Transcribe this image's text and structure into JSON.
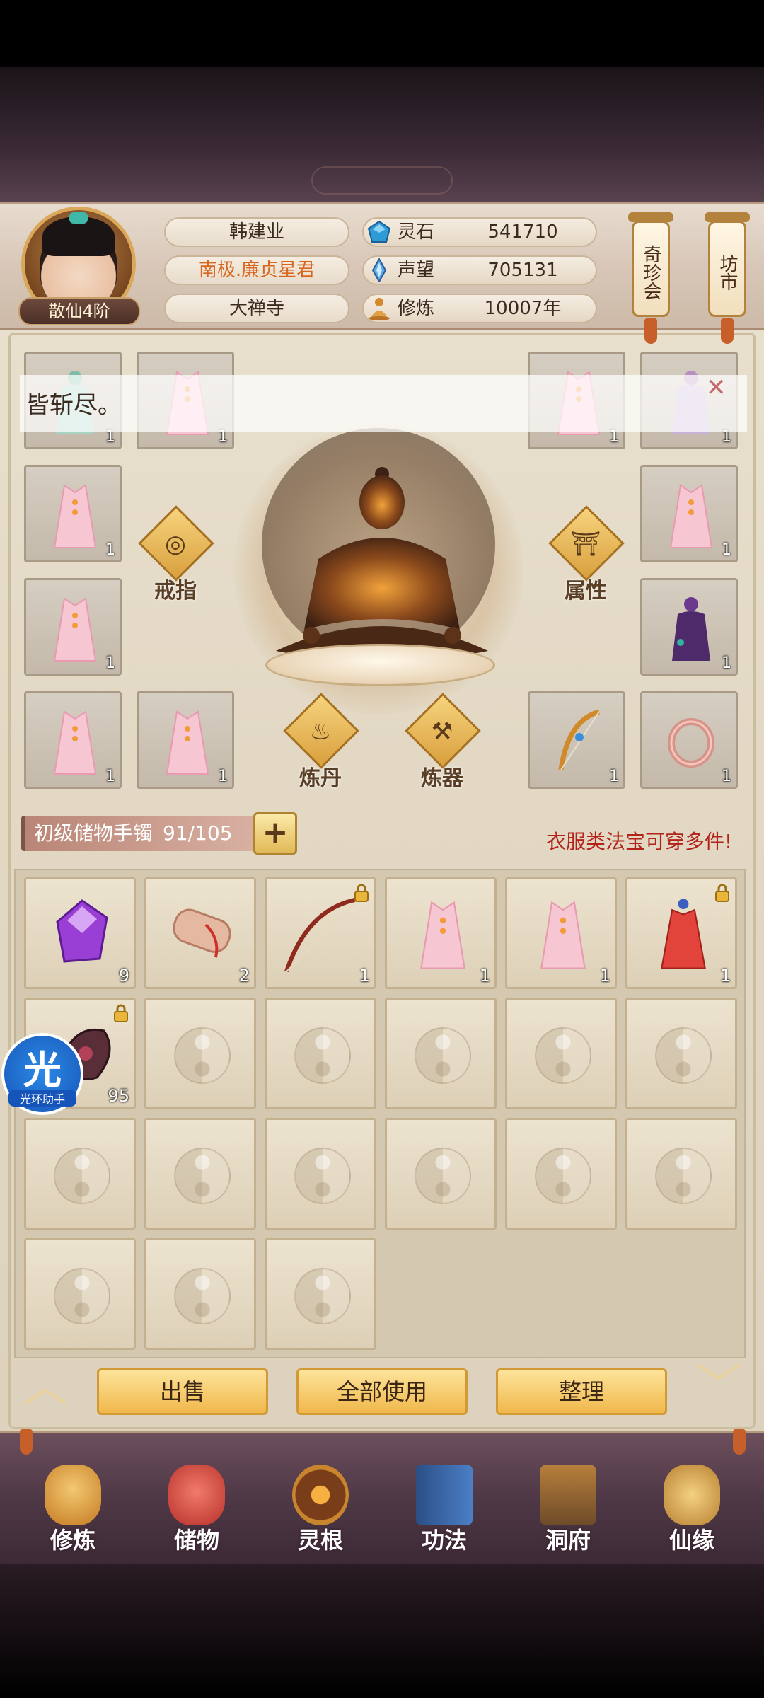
{
  "player": {
    "rank": "散仙4阶",
    "name": "韩建业",
    "title": "南极.廉贞星君",
    "sect": "大禅寺"
  },
  "stats": [
    {
      "label": "灵石",
      "value": "541710",
      "icon": "spirit-stone-icon"
    },
    {
      "label": "声望",
      "value": "705131",
      "icon": "reputation-crystal-icon"
    },
    {
      "label": "修炼",
      "value": "10007年",
      "icon": "meditation-icon"
    }
  ],
  "banners": {
    "treasure": "奇珍会",
    "market": "坊市"
  },
  "notice": {
    "text": "皆斩尽。"
  },
  "equipment": {
    "slots_left": [
      {
        "item": "robe",
        "count": "1"
      },
      {
        "item": "robe",
        "count": "1"
      },
      {
        "item": "robe",
        "count": "1"
      },
      {
        "item": "robe",
        "count": "1"
      },
      {
        "item": "robe",
        "count": "1"
      },
      {
        "item": "robe",
        "count": "1"
      }
    ],
    "slots_right": [
      {
        "item": "robe",
        "count": "1"
      },
      {
        "item": "spirit-figure",
        "count": "1"
      },
      {
        "item": "robe",
        "count": "1"
      },
      {
        "item": "spirit-figure",
        "count": "1"
      },
      {
        "item": "bow",
        "count": "1"
      },
      {
        "item": "ring",
        "count": "1"
      }
    ]
  },
  "buttons": {
    "ring": "戒指",
    "attributes": "属性",
    "alchemy": "炼丹",
    "forging": "炼器"
  },
  "storage": {
    "name": "初级储物手镯",
    "capacity": "91/105",
    "plus": "+",
    "hint": "衣服类法宝可穿多件!"
  },
  "inventory": [
    {
      "item": "purple-crystal",
      "count": "9",
      "locked": false
    },
    {
      "item": "scroll",
      "count": "2",
      "locked": false
    },
    {
      "item": "red-bow",
      "count": "1",
      "locked": true
    },
    {
      "item": "robe",
      "count": "1",
      "locked": false
    },
    {
      "item": "robe",
      "count": "1",
      "locked": false
    },
    {
      "item": "red-dress",
      "count": "1",
      "locked": true
    },
    {
      "item": "dark-artifact",
      "count": "95",
      "locked": true
    }
  ],
  "actions": {
    "sell": "出售",
    "use_all": "全部使用",
    "sort": "整理"
  },
  "nav": [
    {
      "label": "修炼",
      "icon": "cultivation-icon",
      "color": "#e2a343"
    },
    {
      "label": "储物",
      "icon": "storage-bag-icon",
      "color": "#d24b4b"
    },
    {
      "label": "灵根",
      "icon": "spirit-root-icon",
      "color": "#c9772b"
    },
    {
      "label": "功法",
      "icon": "technique-book-icon",
      "color": "#3e6fb0"
    },
    {
      "label": "洞府",
      "icon": "cave-dwelling-icon",
      "color": "#8e6a3a"
    },
    {
      "label": "仙缘",
      "icon": "immortal-fate-icon",
      "color": "#d7a84a"
    }
  ],
  "helper": {
    "glyph": "光",
    "label": "光环助手"
  }
}
